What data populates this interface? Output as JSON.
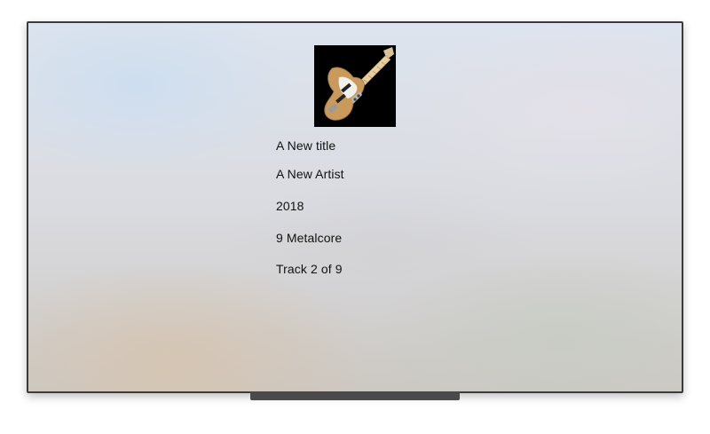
{
  "now_playing": {
    "title": "A New title",
    "artist": "A New Artist",
    "year": "2018",
    "genre": "9 Metalcore",
    "track": "Track 2 of 9",
    "artwork_icon": "bass-guitar-artwork"
  },
  "colors": {
    "text": "#111111",
    "frame": "#3c3c3c",
    "stand": "#4a4a4a",
    "artwork_bg": "#000000"
  }
}
